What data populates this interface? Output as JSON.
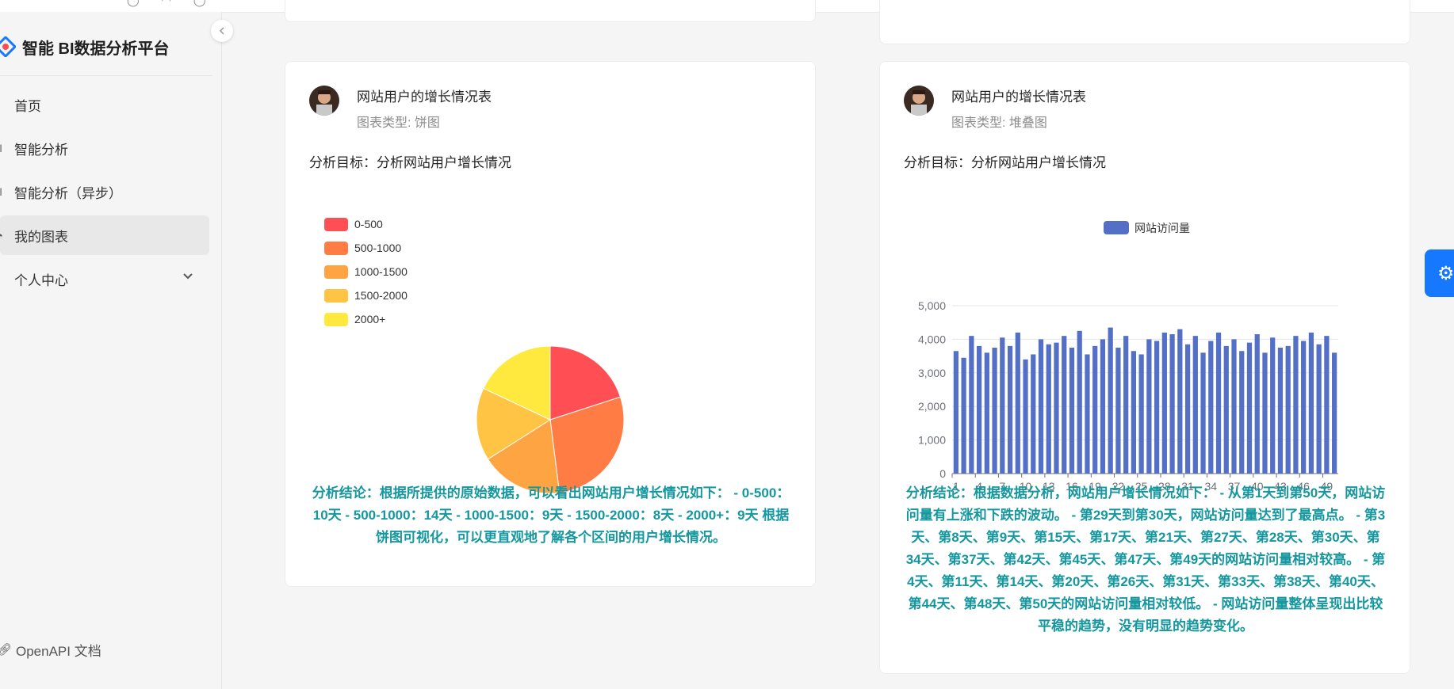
{
  "app": {
    "title": "智能 BI数据分析平台"
  },
  "sidebar": {
    "items": [
      {
        "label": "首页",
        "icon": "home-icon"
      },
      {
        "label": "智能分析",
        "icon": "bar-chart-icon"
      },
      {
        "label": "智能分析（异步）",
        "icon": "bar-chart-icon"
      },
      {
        "label": "我的图表",
        "icon": "pie-chart-icon",
        "active": true
      },
      {
        "label": "个人中心",
        "icon": "user-icon",
        "expandable": true
      }
    ],
    "openapi_label": "OpenAPI 文档"
  },
  "cards": [
    {
      "name": "网站用户的增长情况表",
      "type": "图表类型: 饼图",
      "goal": "分析目标：分析网站用户增长情况",
      "conclusion": "分析结论：根据所提供的原始数据，可以看出网站用户增长情况如下： - 0-500：10天 - 500-1000：14天 - 1000-1500：9天 - 1500-2000：8天 - 2000+：9天 根据饼图可视化，可以更直观地了解各个区间的用户增长情况。"
    },
    {
      "name": "网站用户的增长情况表",
      "type": "图表类型: 堆叠图",
      "goal": "分析目标：分析网站用户增长情况",
      "conclusion": "分析结论：根据数据分析，网站用户增长情况如下： - 从第1天到第50天，网站访问量有上涨和下跌的波动。 - 第29天到第30天，网站访问量达到了最高点。 - 第3天、第8天、第9天、第15天、第17天、第21天、第27天、第28天、第30天、第34天、第37天、第42天、第45天、第47天、第49天的网站访问量相对较高。 - 第4天、第11天、第14天、第20天、第26天、第31天、第33天、第38天、第40天、第44天、第48天、第50天的网站访问量相对较低。 - 网站访问量整体呈现出比较平稳的趋势，没有明显的趋势变化。"
    }
  ],
  "chart_data": [
    {
      "type": "pie",
      "categories": [
        "0-500",
        "500-1000",
        "1000-1500",
        "1500-2000",
        "2000+"
      ],
      "values": [
        10,
        14,
        9,
        8,
        9
      ],
      "colors": [
        "#ff4f55",
        "#ff7d45",
        "#ffa443",
        "#ffc443",
        "#ffe93f"
      ],
      "legend": "top-left"
    },
    {
      "type": "bar",
      "series": [
        {
          "name": "网站访问量",
          "color": "#5470c6",
          "values": [
            3650,
            3450,
            4100,
            3800,
            3600,
            3750,
            4050,
            3800,
            4200,
            3400,
            3550,
            4000,
            3850,
            3900,
            4100,
            3750,
            4250,
            3550,
            3800,
            4000,
            4350,
            3750,
            4100,
            3650,
            3550,
            4000,
            3950,
            4200,
            4150,
            4300,
            3850,
            4100,
            3600,
            3950,
            4200,
            3800,
            4000,
            3650,
            3900,
            4150,
            3600,
            4050,
            3750,
            3800,
            4100,
            3950,
            4200,
            3850,
            4100,
            3600
          ]
        }
      ],
      "x": [
        1,
        2,
        3,
        4,
        5,
        6,
        7,
        8,
        9,
        10,
        11,
        12,
        13,
        14,
        15,
        16,
        17,
        18,
        19,
        20,
        21,
        22,
        23,
        24,
        25,
        26,
        27,
        28,
        29,
        30,
        31,
        32,
        33,
        34,
        35,
        36,
        37,
        38,
        39,
        40,
        41,
        42,
        43,
        44,
        45,
        46,
        47,
        48,
        49,
        50
      ],
      "xticks": [
        1,
        4,
        7,
        10,
        13,
        16,
        19,
        22,
        25,
        28,
        31,
        34,
        37,
        40,
        43,
        46,
        49
      ],
      "yticks": [
        "0",
        "1,000",
        "2,000",
        "3,000",
        "4,000",
        "5,000"
      ],
      "ylim": [
        0,
        5000
      ],
      "grid": true,
      "legend": "top-center"
    }
  ]
}
